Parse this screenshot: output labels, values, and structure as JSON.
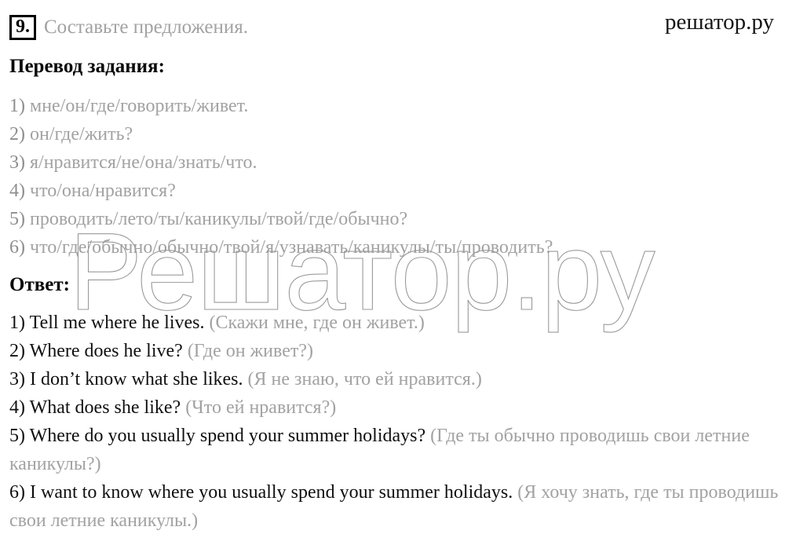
{
  "site": {
    "logo_text": "решатор.ру",
    "watermark_text": "Решатор.ру",
    "watermark_color": "#9a9a9a"
  },
  "task": {
    "number": "9.",
    "title": "Составьте предложения."
  },
  "translation_section": {
    "heading": "Перевод задания:",
    "items": [
      {
        "marker": "1)",
        "text": "мне/он/где/говорить/живет."
      },
      {
        "marker": "2)",
        "text": "он/где/жить?"
      },
      {
        "marker": "3)",
        "text": "я/нравится/не/она/знать/что."
      },
      {
        "marker": "4)",
        "text": "что/она/нравится?"
      },
      {
        "marker": "5)",
        "text": "проводить/лето/ты/каникулы/твой/где/обычно?"
      },
      {
        "marker": "6)",
        "text": "что/где/обычно/обычно/твой/я/узнавать/каникулы/ты/проводить?"
      }
    ]
  },
  "answer_section": {
    "heading": "Ответ:",
    "items": [
      {
        "marker": "1)",
        "english": "Tell me where he lives.",
        "russian": "(Скажи мне, где он живет.)"
      },
      {
        "marker": "2)",
        "english": "Where does he live?",
        "russian": "(Где он живет?)"
      },
      {
        "marker": "3)",
        "english": "I don’t know what she likes.",
        "russian": "(Я не знаю, что ей нравится.)"
      },
      {
        "marker": "4)",
        "english": "What does she like?",
        "russian": "(Что ей нравится?)"
      },
      {
        "marker": "5)",
        "english": "Where do you usually spend your summer holidays?",
        "russian": "(Где ты обычно проводишь свои летние каникулы?)"
      },
      {
        "marker": "6)",
        "english": "I want to know where you usually spend your summer holidays.",
        "russian": "(Я хочу знать, где ты проводишь свои летние каникулы.)"
      }
    ]
  },
  "colors": {
    "gray_text": "#a2a2a2",
    "black_text": "#101010"
  }
}
